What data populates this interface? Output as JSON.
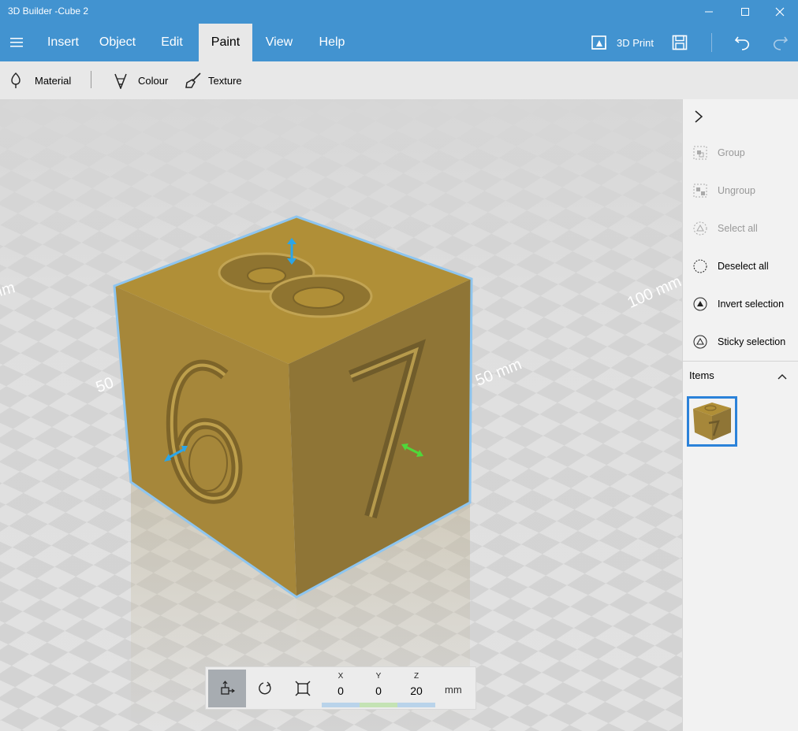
{
  "window": {
    "title": "3D Builder -Cube 2"
  },
  "menu": {
    "items": [
      {
        "label": "Insert"
      },
      {
        "label": "Object"
      },
      {
        "label": "Edit"
      },
      {
        "label": "Paint"
      },
      {
        "label": "View"
      },
      {
        "label": "Help"
      }
    ],
    "active": "Paint",
    "print_label": "3D Print"
  },
  "toolbar": {
    "material_label": "Material",
    "colour_label": "Colour",
    "texture_label": "Texture"
  },
  "viewport": {
    "axis_labels": [
      "mm",
      "50",
      "50 mm",
      "100 mm"
    ],
    "object": {
      "top_digit": "8",
      "left_digit": "6",
      "right_digit": "7",
      "color": "#a08232"
    }
  },
  "side_panel": {
    "actions": [
      {
        "label": "Group",
        "enabled": false
      },
      {
        "label": "Ungroup",
        "enabled": false
      },
      {
        "label": "Select all",
        "enabled": false
      },
      {
        "label": "Deselect all",
        "enabled": true
      },
      {
        "label": "Invert selection",
        "enabled": true
      },
      {
        "label": "Sticky selection",
        "enabled": true
      }
    ],
    "items_title": "Items"
  },
  "transform": {
    "x_label": "X",
    "x": "0",
    "y_label": "Y",
    "y": "0",
    "z_label": "Z",
    "z": "20",
    "unit": "mm"
  },
  "colors": {
    "accent": "#4293d0",
    "selection": "#2b82d9",
    "x_bar": "#b9d3ea",
    "y_bar": "#c4e3b4",
    "z_bar": "#b9d3ea"
  }
}
